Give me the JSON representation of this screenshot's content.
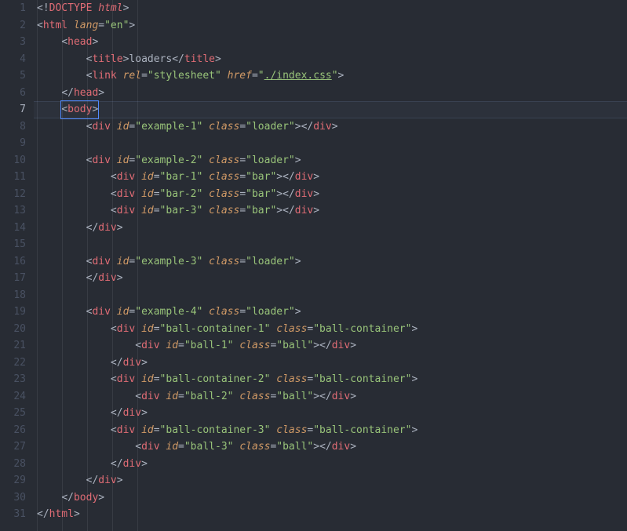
{
  "totalLines": 31,
  "currentLine": 7,
  "indentGuides": [
    4,
    36,
    68,
    100,
    132
  ],
  "lines": [
    {
      "n": 1,
      "indent": 0,
      "tokens": [
        {
          "t": "<!",
          "c": "def"
        },
        {
          "t": "DOCTYPE ",
          "c": "tag"
        },
        {
          "t": "html",
          "c": "doc"
        },
        {
          "t": ">",
          "c": "def"
        }
      ]
    },
    {
      "n": 2,
      "indent": 0,
      "tokens": [
        {
          "t": "<",
          "c": "def"
        },
        {
          "t": "html",
          "c": "tag"
        },
        {
          "t": " ",
          "c": "def"
        },
        {
          "t": "lang",
          "c": "attr"
        },
        {
          "t": "=",
          "c": "def"
        },
        {
          "t": "\"en\"",
          "c": "str"
        },
        {
          "t": ">",
          "c": "def"
        }
      ]
    },
    {
      "n": 3,
      "indent": 1,
      "tokens": [
        {
          "t": "<",
          "c": "def"
        },
        {
          "t": "head",
          "c": "tag"
        },
        {
          "t": ">",
          "c": "def"
        }
      ]
    },
    {
      "n": 4,
      "indent": 2,
      "tokens": [
        {
          "t": "<",
          "c": "def"
        },
        {
          "t": "title",
          "c": "tag"
        },
        {
          "t": ">",
          "c": "def"
        },
        {
          "t": "loaders",
          "c": "text"
        },
        {
          "t": "</",
          "c": "def"
        },
        {
          "t": "title",
          "c": "tag"
        },
        {
          "t": ">",
          "c": "def"
        }
      ]
    },
    {
      "n": 5,
      "indent": 2,
      "tokens": [
        {
          "t": "<",
          "c": "def"
        },
        {
          "t": "link",
          "c": "tag"
        },
        {
          "t": " ",
          "c": "def"
        },
        {
          "t": "rel",
          "c": "attr"
        },
        {
          "t": "=",
          "c": "def"
        },
        {
          "t": "\"stylesheet\"",
          "c": "str"
        },
        {
          "t": " ",
          "c": "def"
        },
        {
          "t": "href",
          "c": "attr"
        },
        {
          "t": "=",
          "c": "def"
        },
        {
          "t": "\"",
          "c": "str"
        },
        {
          "t": "./index.css",
          "c": "href"
        },
        {
          "t": "\"",
          "c": "str"
        },
        {
          "t": ">",
          "c": "def"
        }
      ]
    },
    {
      "n": 6,
      "indent": 1,
      "tokens": [
        {
          "t": "</",
          "c": "def"
        },
        {
          "t": "head",
          "c": "tag"
        },
        {
          "t": ">",
          "c": "def"
        }
      ]
    },
    {
      "n": 7,
      "indent": 1,
      "cursor": true,
      "tokens": [
        {
          "t": "<",
          "c": "def"
        },
        {
          "t": "body",
          "c": "tag"
        },
        {
          "t": ">",
          "c": "def"
        }
      ]
    },
    {
      "n": 8,
      "indent": 2,
      "tokens": [
        {
          "t": "<",
          "c": "def"
        },
        {
          "t": "div",
          "c": "tag"
        },
        {
          "t": " ",
          "c": "def"
        },
        {
          "t": "id",
          "c": "attr"
        },
        {
          "t": "=",
          "c": "def"
        },
        {
          "t": "\"example-1\"",
          "c": "str"
        },
        {
          "t": " ",
          "c": "def"
        },
        {
          "t": "class",
          "c": "attr"
        },
        {
          "t": "=",
          "c": "def"
        },
        {
          "t": "\"loader\"",
          "c": "str"
        },
        {
          "t": "></",
          "c": "def"
        },
        {
          "t": "div",
          "c": "tag"
        },
        {
          "t": ">",
          "c": "def"
        }
      ]
    },
    {
      "n": 9,
      "indent": 0,
      "tokens": []
    },
    {
      "n": 10,
      "indent": 2,
      "tokens": [
        {
          "t": "<",
          "c": "def"
        },
        {
          "t": "div",
          "c": "tag"
        },
        {
          "t": " ",
          "c": "def"
        },
        {
          "t": "id",
          "c": "attr"
        },
        {
          "t": "=",
          "c": "def"
        },
        {
          "t": "\"example-2\"",
          "c": "str"
        },
        {
          "t": " ",
          "c": "def"
        },
        {
          "t": "class",
          "c": "attr"
        },
        {
          "t": "=",
          "c": "def"
        },
        {
          "t": "\"loader\"",
          "c": "str"
        },
        {
          "t": ">",
          "c": "def"
        }
      ]
    },
    {
      "n": 11,
      "indent": 3,
      "tokens": [
        {
          "t": "<",
          "c": "def"
        },
        {
          "t": "div",
          "c": "tag"
        },
        {
          "t": " ",
          "c": "def"
        },
        {
          "t": "id",
          "c": "attr"
        },
        {
          "t": "=",
          "c": "def"
        },
        {
          "t": "\"bar-1\"",
          "c": "str"
        },
        {
          "t": " ",
          "c": "def"
        },
        {
          "t": "class",
          "c": "attr"
        },
        {
          "t": "=",
          "c": "def"
        },
        {
          "t": "\"bar\"",
          "c": "str"
        },
        {
          "t": "></",
          "c": "def"
        },
        {
          "t": "div",
          "c": "tag"
        },
        {
          "t": ">",
          "c": "def"
        }
      ]
    },
    {
      "n": 12,
      "indent": 3,
      "tokens": [
        {
          "t": "<",
          "c": "def"
        },
        {
          "t": "div",
          "c": "tag"
        },
        {
          "t": " ",
          "c": "def"
        },
        {
          "t": "id",
          "c": "attr"
        },
        {
          "t": "=",
          "c": "def"
        },
        {
          "t": "\"bar-2\"",
          "c": "str"
        },
        {
          "t": " ",
          "c": "def"
        },
        {
          "t": "class",
          "c": "attr"
        },
        {
          "t": "=",
          "c": "def"
        },
        {
          "t": "\"bar\"",
          "c": "str"
        },
        {
          "t": "></",
          "c": "def"
        },
        {
          "t": "div",
          "c": "tag"
        },
        {
          "t": ">",
          "c": "def"
        }
      ]
    },
    {
      "n": 13,
      "indent": 3,
      "tokens": [
        {
          "t": "<",
          "c": "def"
        },
        {
          "t": "div",
          "c": "tag"
        },
        {
          "t": " ",
          "c": "def"
        },
        {
          "t": "id",
          "c": "attr"
        },
        {
          "t": "=",
          "c": "def"
        },
        {
          "t": "\"bar-3\"",
          "c": "str"
        },
        {
          "t": " ",
          "c": "def"
        },
        {
          "t": "class",
          "c": "attr"
        },
        {
          "t": "=",
          "c": "def"
        },
        {
          "t": "\"bar\"",
          "c": "str"
        },
        {
          "t": "></",
          "c": "def"
        },
        {
          "t": "div",
          "c": "tag"
        },
        {
          "t": ">",
          "c": "def"
        }
      ]
    },
    {
      "n": 14,
      "indent": 2,
      "tokens": [
        {
          "t": "</",
          "c": "def"
        },
        {
          "t": "div",
          "c": "tag"
        },
        {
          "t": ">",
          "c": "def"
        }
      ]
    },
    {
      "n": 15,
      "indent": 0,
      "tokens": []
    },
    {
      "n": 16,
      "indent": 2,
      "tokens": [
        {
          "t": "<",
          "c": "def"
        },
        {
          "t": "div",
          "c": "tag"
        },
        {
          "t": " ",
          "c": "def"
        },
        {
          "t": "id",
          "c": "attr"
        },
        {
          "t": "=",
          "c": "def"
        },
        {
          "t": "\"example-3\"",
          "c": "str"
        },
        {
          "t": " ",
          "c": "def"
        },
        {
          "t": "class",
          "c": "attr"
        },
        {
          "t": "=",
          "c": "def"
        },
        {
          "t": "\"loader\"",
          "c": "str"
        },
        {
          "t": ">",
          "c": "def"
        }
      ]
    },
    {
      "n": 17,
      "indent": 2,
      "tokens": [
        {
          "t": "</",
          "c": "def"
        },
        {
          "t": "div",
          "c": "tag"
        },
        {
          "t": ">",
          "c": "def"
        }
      ]
    },
    {
      "n": 18,
      "indent": 0,
      "tokens": []
    },
    {
      "n": 19,
      "indent": 2,
      "tokens": [
        {
          "t": "<",
          "c": "def"
        },
        {
          "t": "div",
          "c": "tag"
        },
        {
          "t": " ",
          "c": "def"
        },
        {
          "t": "id",
          "c": "attr"
        },
        {
          "t": "=",
          "c": "def"
        },
        {
          "t": "\"example-4\"",
          "c": "str"
        },
        {
          "t": " ",
          "c": "def"
        },
        {
          "t": "class",
          "c": "attr"
        },
        {
          "t": "=",
          "c": "def"
        },
        {
          "t": "\"loader\"",
          "c": "str"
        },
        {
          "t": ">",
          "c": "def"
        }
      ]
    },
    {
      "n": 20,
      "indent": 3,
      "tokens": [
        {
          "t": "<",
          "c": "def"
        },
        {
          "t": "div",
          "c": "tag"
        },
        {
          "t": " ",
          "c": "def"
        },
        {
          "t": "id",
          "c": "attr"
        },
        {
          "t": "=",
          "c": "def"
        },
        {
          "t": "\"ball-container-1\"",
          "c": "str"
        },
        {
          "t": " ",
          "c": "def"
        },
        {
          "t": "class",
          "c": "attr"
        },
        {
          "t": "=",
          "c": "def"
        },
        {
          "t": "\"ball-container\"",
          "c": "str"
        },
        {
          "t": ">",
          "c": "def"
        }
      ]
    },
    {
      "n": 21,
      "indent": 4,
      "tokens": [
        {
          "t": "<",
          "c": "def"
        },
        {
          "t": "div",
          "c": "tag"
        },
        {
          "t": " ",
          "c": "def"
        },
        {
          "t": "id",
          "c": "attr"
        },
        {
          "t": "=",
          "c": "def"
        },
        {
          "t": "\"ball-1\"",
          "c": "str"
        },
        {
          "t": " ",
          "c": "def"
        },
        {
          "t": "class",
          "c": "attr"
        },
        {
          "t": "=",
          "c": "def"
        },
        {
          "t": "\"ball\"",
          "c": "str"
        },
        {
          "t": "></",
          "c": "def"
        },
        {
          "t": "div",
          "c": "tag"
        },
        {
          "t": ">",
          "c": "def"
        }
      ]
    },
    {
      "n": 22,
      "indent": 3,
      "tokens": [
        {
          "t": "</",
          "c": "def"
        },
        {
          "t": "div",
          "c": "tag"
        },
        {
          "t": ">",
          "c": "def"
        }
      ]
    },
    {
      "n": 23,
      "indent": 3,
      "tokens": [
        {
          "t": "<",
          "c": "def"
        },
        {
          "t": "div",
          "c": "tag"
        },
        {
          "t": " ",
          "c": "def"
        },
        {
          "t": "id",
          "c": "attr"
        },
        {
          "t": "=",
          "c": "def"
        },
        {
          "t": "\"ball-container-2\"",
          "c": "str"
        },
        {
          "t": " ",
          "c": "def"
        },
        {
          "t": "class",
          "c": "attr"
        },
        {
          "t": "=",
          "c": "def"
        },
        {
          "t": "\"ball-container\"",
          "c": "str"
        },
        {
          "t": ">",
          "c": "def"
        }
      ]
    },
    {
      "n": 24,
      "indent": 4,
      "tokens": [
        {
          "t": "<",
          "c": "def"
        },
        {
          "t": "div",
          "c": "tag"
        },
        {
          "t": " ",
          "c": "def"
        },
        {
          "t": "id",
          "c": "attr"
        },
        {
          "t": "=",
          "c": "def"
        },
        {
          "t": "\"ball-2\"",
          "c": "str"
        },
        {
          "t": " ",
          "c": "def"
        },
        {
          "t": "class",
          "c": "attr"
        },
        {
          "t": "=",
          "c": "def"
        },
        {
          "t": "\"ball\"",
          "c": "str"
        },
        {
          "t": "></",
          "c": "def"
        },
        {
          "t": "div",
          "c": "tag"
        },
        {
          "t": ">",
          "c": "def"
        }
      ]
    },
    {
      "n": 25,
      "indent": 3,
      "tokens": [
        {
          "t": "</",
          "c": "def"
        },
        {
          "t": "div",
          "c": "tag"
        },
        {
          "t": ">",
          "c": "def"
        }
      ]
    },
    {
      "n": 26,
      "indent": 3,
      "tokens": [
        {
          "t": "<",
          "c": "def"
        },
        {
          "t": "div",
          "c": "tag"
        },
        {
          "t": " ",
          "c": "def"
        },
        {
          "t": "id",
          "c": "attr"
        },
        {
          "t": "=",
          "c": "def"
        },
        {
          "t": "\"ball-container-3\"",
          "c": "str"
        },
        {
          "t": " ",
          "c": "def"
        },
        {
          "t": "class",
          "c": "attr"
        },
        {
          "t": "=",
          "c": "def"
        },
        {
          "t": "\"ball-container\"",
          "c": "str"
        },
        {
          "t": ">",
          "c": "def"
        }
      ]
    },
    {
      "n": 27,
      "indent": 4,
      "tokens": [
        {
          "t": "<",
          "c": "def"
        },
        {
          "t": "div",
          "c": "tag"
        },
        {
          "t": " ",
          "c": "def"
        },
        {
          "t": "id",
          "c": "attr"
        },
        {
          "t": "=",
          "c": "def"
        },
        {
          "t": "\"ball-3\"",
          "c": "str"
        },
        {
          "t": " ",
          "c": "def"
        },
        {
          "t": "class",
          "c": "attr"
        },
        {
          "t": "=",
          "c": "def"
        },
        {
          "t": "\"ball\"",
          "c": "str"
        },
        {
          "t": "></",
          "c": "def"
        },
        {
          "t": "div",
          "c": "tag"
        },
        {
          "t": ">",
          "c": "def"
        }
      ]
    },
    {
      "n": 28,
      "indent": 3,
      "tokens": [
        {
          "t": "</",
          "c": "def"
        },
        {
          "t": "div",
          "c": "tag"
        },
        {
          "t": ">",
          "c": "def"
        }
      ]
    },
    {
      "n": 29,
      "indent": 2,
      "tokens": [
        {
          "t": "</",
          "c": "def"
        },
        {
          "t": "div",
          "c": "tag"
        },
        {
          "t": ">",
          "c": "def"
        }
      ]
    },
    {
      "n": 30,
      "indent": 1,
      "tokens": [
        {
          "t": "</",
          "c": "def"
        },
        {
          "t": "body",
          "c": "tag"
        },
        {
          "t": ">",
          "c": "def"
        }
      ]
    },
    {
      "n": 31,
      "indent": 0,
      "tokens": [
        {
          "t": "</",
          "c": "def"
        },
        {
          "t": "html",
          "c": "tag"
        },
        {
          "t": ">",
          "c": "def"
        }
      ]
    }
  ]
}
